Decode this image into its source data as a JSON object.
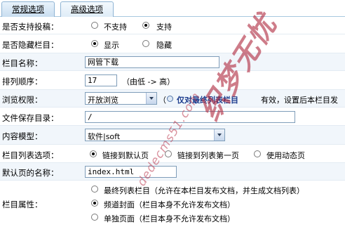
{
  "tabs": [
    {
      "label": "常规选项",
      "active": true
    },
    {
      "label": "高级选项",
      "active": false
    }
  ],
  "fields": {
    "allow_submit": {
      "label": "是否支持投稿：",
      "options": [
        "不支持",
        "支持"
      ],
      "selected": "支持"
    },
    "hidden": {
      "label": "是否隐藏栏目：",
      "options": [
        "显示",
        "隐藏"
      ],
      "selected": "显示"
    },
    "name": {
      "label": "栏目名称：",
      "value": "网管下载"
    },
    "order": {
      "label": "排列顺序：",
      "value": "17",
      "hint": "（由低 -> 高）"
    },
    "permission": {
      "label": "浏览权限：",
      "value": "开放浏览",
      "note_prefix": "（",
      "note_bold": "仅对最终列表栏目",
      "note_suffix": "有效，设置后本栏目发"
    },
    "save_dir": {
      "label": "文件保存目录：",
      "value": "/"
    },
    "content_model": {
      "label": "内容模型：",
      "value": "软件|soft"
    },
    "list_option": {
      "label": "栏目列表选项：",
      "options": [
        "链接到默认页",
        "链接到列表第一页",
        "使用动态页"
      ],
      "selected": "链接到默认页"
    },
    "default_page": {
      "label": "默认页的名称：",
      "value": "index.html"
    },
    "attribute": {
      "label": "栏目属性：",
      "options": [
        "最终列表栏目（允许在本栏目发布文档，并生成文档列表）",
        "频道封面（栏目本身不允许发布文档）",
        "单独页面（栏目本身不允许发布文档）"
      ],
      "selected": "频道封面（栏目本身不允许发布文档）"
    }
  },
  "watermark": {
    "text": "织梦无忧",
    "url": "dedecms51.com"
  }
}
